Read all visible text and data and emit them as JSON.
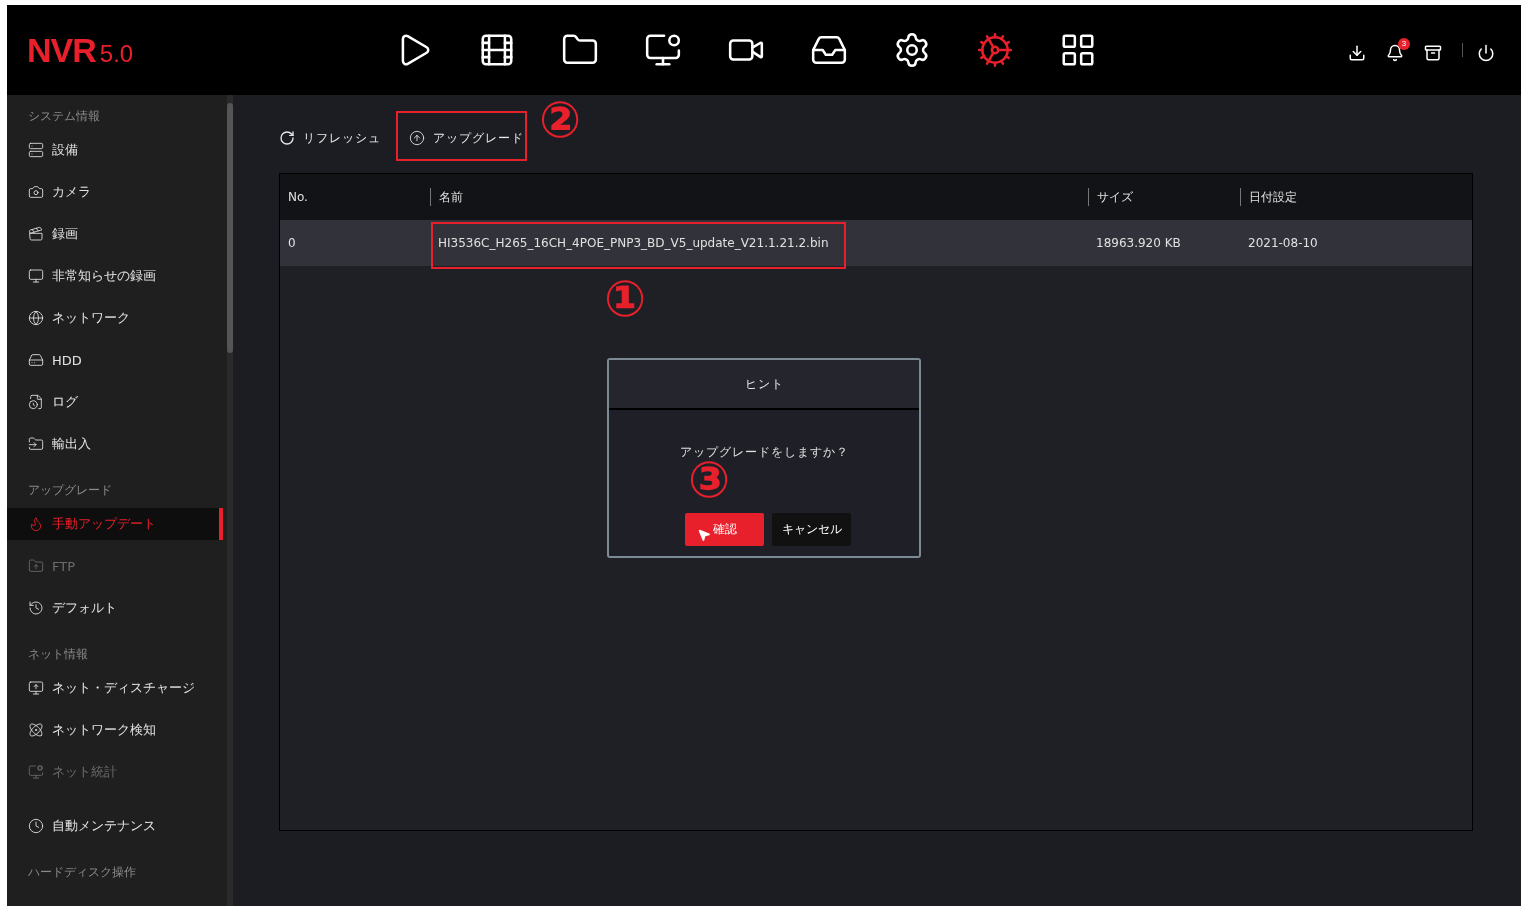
{
  "logo": {
    "name": "NVR",
    "version": "5.0"
  },
  "nav": [
    {
      "selected": false
    },
    {
      "selected": false
    },
    {
      "selected": false
    },
    {
      "selected": false
    },
    {
      "selected": false
    },
    {
      "selected": false
    },
    {
      "selected": false
    },
    {
      "selected": true
    },
    {
      "selected": false
    }
  ],
  "notifications": {
    "badge": "3"
  },
  "sidebar": {
    "sections": [
      {
        "title": "システム情報",
        "items": [
          {
            "label": "設備",
            "selected": false,
            "disabled": false
          },
          {
            "label": "カメラ",
            "selected": false,
            "disabled": false
          },
          {
            "label": "録画",
            "selected": false,
            "disabled": false
          },
          {
            "label": "非常知らせの録画",
            "selected": false,
            "disabled": false
          },
          {
            "label": "ネットワーク",
            "selected": false,
            "disabled": false
          },
          {
            "label": "HDD",
            "selected": false,
            "disabled": false
          },
          {
            "label": "ログ",
            "selected": false,
            "disabled": false
          },
          {
            "label": "輸出入",
            "selected": false,
            "disabled": false
          }
        ]
      },
      {
        "title": "アップグレード",
        "items": [
          {
            "label": "手動アップデート",
            "selected": true,
            "disabled": false
          },
          {
            "label": "FTP",
            "selected": false,
            "disabled": true
          },
          {
            "label": "デフォルト",
            "selected": false,
            "disabled": false
          }
        ]
      },
      {
        "title": "ネット情報",
        "items": [
          {
            "label": "ネット・ディスチャージ",
            "selected": false,
            "disabled": false
          },
          {
            "label": "ネットワーク検知",
            "selected": false,
            "disabled": false
          },
          {
            "label": "ネット統計",
            "selected": false,
            "disabled": true
          }
        ]
      },
      {
        "items": [
          {
            "label": "自動メンテナンス",
            "selected": false,
            "disabled": false
          }
        ]
      },
      {
        "title": "ハードディスク操作"
      }
    ]
  },
  "toolbar": {
    "refresh": "リフレッシュ",
    "upgrade": "アップグレード"
  },
  "table": {
    "columns": [
      "No.",
      "名前",
      "サイズ",
      "日付設定"
    ],
    "rows": [
      {
        "cells": [
          "0",
          "HI3536C_H265_16CH_4POE_PNP3_BD_V5_update_V21.1.21.2.bin",
          "18963.920 KB",
          "2021-08-10"
        ],
        "selected": true
      }
    ]
  },
  "dialog": {
    "title": "ヒント",
    "message": "アップグレードをしますか？",
    "confirm": "確認",
    "cancel": "キャンセル"
  },
  "annotations": [
    "①",
    "②",
    "③"
  ]
}
